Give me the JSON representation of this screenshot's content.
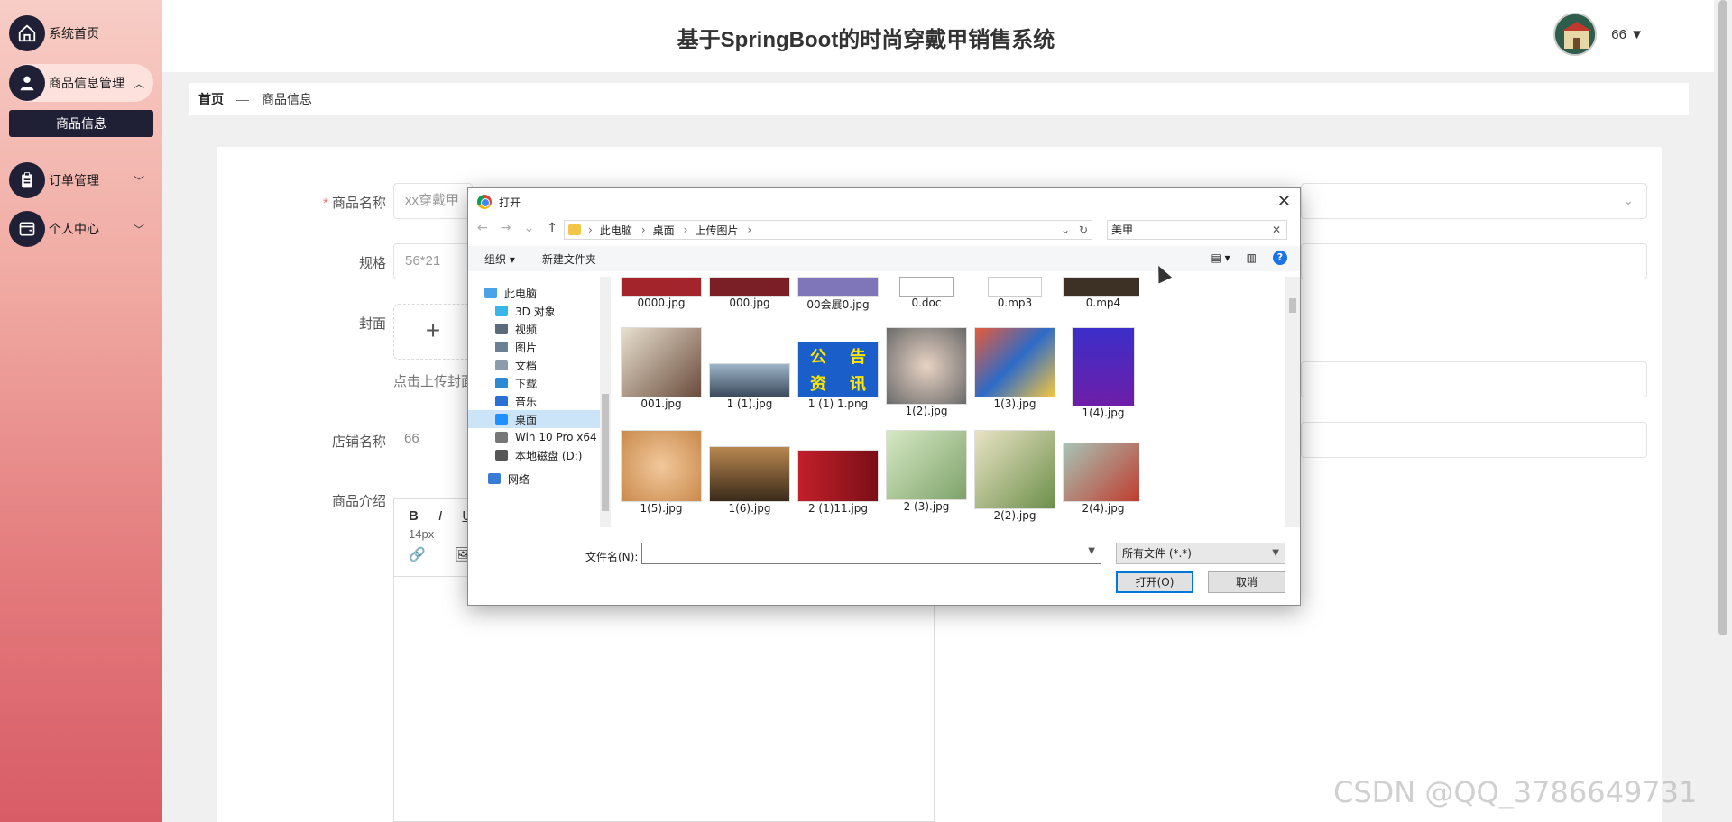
{
  "app": {
    "title": "基于SpringBoot的时尚穿戴甲销售系统",
    "user": "66"
  },
  "sidebar": {
    "home": "系统首页",
    "product_mgmt": "商品信息管理",
    "product_info": "商品信息",
    "order_mgmt": "订单管理",
    "personal": "个人中心"
  },
  "breadcrumb": {
    "home": "首页",
    "sep": "—",
    "current": "商品信息"
  },
  "form": {
    "name_label": "商品名称",
    "name_value": "xx穿戴甲",
    "spec_label": "规格",
    "spec_value": "56*21",
    "cover_label": "封面",
    "upload_plus": "+",
    "cover_hint": "点击上传封面",
    "shop_label": "店铺名称",
    "shop_value": "66",
    "intro_label": "商品介绍",
    "editor_bold": "B",
    "editor_italic": "I",
    "editor_underline": "U",
    "editor_fontsize": "14px"
  },
  "dialog": {
    "title": "打开",
    "address": [
      "此电脑",
      "桌面",
      "上传图片"
    ],
    "search": "美甲",
    "organize": "组织 ▾",
    "new_folder": "新建文件夹",
    "tree": [
      "此电脑",
      "3D 对象",
      "视频",
      "图片",
      "文档",
      "下载",
      "音乐",
      "桌面",
      "Win 10 Pro x64",
      "本地磁盘 (D:)",
      "网络"
    ],
    "files_row1": [
      "0000.jpg",
      "000.jpg",
      "00会展0.jpg",
      "0.doc",
      "0.mp3",
      "0.mp4"
    ],
    "files_row2": [
      "001.jpg",
      "1 (1).jpg",
      "1 (1) 1.png",
      "1(2).jpg",
      "1(3).jpg",
      "1(4).jpg"
    ],
    "files_row3": [
      "1(5).jpg",
      "1(6).jpg",
      "2 (1)11.jpg",
      "2 (3).jpg",
      "2(2).jpg",
      "2(4).jpg"
    ],
    "notice_text": [
      "公",
      "告",
      "资",
      "讯"
    ],
    "filename_label": "文件名(N):",
    "filename_value": "",
    "file_type": "所有文件 (*.*)",
    "open_btn": "打开(O)",
    "cancel_btn": "取消"
  },
  "watermark": "CSDN @QQ_3786649731"
}
